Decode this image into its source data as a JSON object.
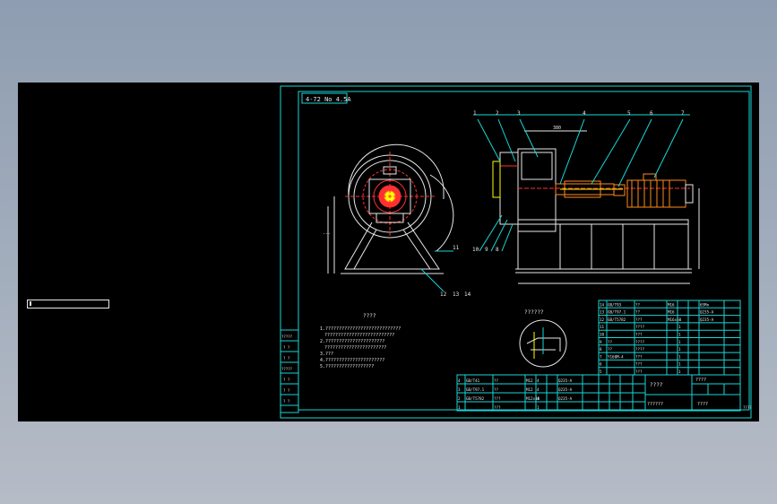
{
  "drawing": {
    "title_tag": "4-72 No 4.5A",
    "part_numbers_top": [
      "1",
      "2",
      "3",
      "4",
      "5",
      "6",
      "7"
    ],
    "part_numbers_bottom": [
      "10",
      "9",
      "8"
    ],
    "part_number_right": "11",
    "part_numbers_base": [
      "12",
      "13",
      "14"
    ],
    "dim_top": "380",
    "detail_label": "??????",
    "notes_title": "????",
    "notes": [
      "1.????????????????????????????",
      "??????????????????????????",
      "2.??????????????????????",
      "???????????????????????",
      "3.???",
      "4.??????????????????????",
      "5.??????????????????"
    ],
    "bom_rows": [
      [
        "14",
        "GB/T93",
        "??",
        "M16",
        "",
        "",
        "65Mn",
        ""
      ],
      [
        "13",
        "GB/T97.1",
        "??",
        "M16",
        "",
        "",
        "Q235-A",
        ""
      ],
      [
        "12",
        "GB/T5782",
        "???",
        "M16x60",
        "",
        "",
        "Q235-A",
        ""
      ],
      [
        "11",
        "",
        "????",
        "",
        "1",
        "",
        "",
        ""
      ],
      [
        "10",
        "",
        "???",
        "",
        "1",
        "",
        "",
        ""
      ],
      [
        "9",
        "??",
        "????",
        "",
        "1",
        "",
        "",
        ""
      ],
      [
        "8",
        "??",
        "????",
        "",
        "1",
        "",
        "",
        ""
      ],
      [
        "7",
        "Y160M-4",
        "???",
        "",
        "1",
        "",
        "",
        ""
      ],
      [
        "6",
        "",
        "???",
        "",
        "1",
        "",
        "",
        ""
      ],
      [
        "5",
        "",
        "???",
        "",
        "1",
        "",
        "",
        ""
      ]
    ],
    "bom_rows_lower": [
      [
        "4",
        "GB/T41",
        "??",
        "M12",
        "4",
        "",
        "Q235-A",
        ""
      ],
      [
        "3",
        "GB/T97.1",
        "??",
        "M12",
        "4",
        "",
        "Q235-A",
        ""
      ],
      [
        "2",
        "GB/T5782",
        "???",
        "M12x40",
        "4",
        "",
        "Q235-A",
        ""
      ],
      [
        "1",
        "",
        "???",
        "",
        "1",
        "",
        "",
        ""
      ]
    ],
    "title_block": {
      "name": "????",
      "drawing_no": "??????",
      "company": "????"
    },
    "left_strip": [
      "?????",
      "?  ?",
      "?  ?",
      "?????",
      "?  ?",
      "?  ?",
      "?  ?"
    ],
    "corner_text": "????"
  },
  "colors": {
    "frame": "#19d6d6",
    "lines": "#e8e8e8",
    "highlight": "#ff3030",
    "motor": "#ff8a1a",
    "yellow": "#ffff00"
  }
}
